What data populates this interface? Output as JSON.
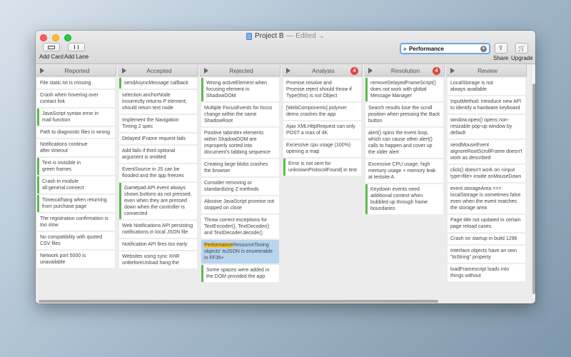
{
  "window": {
    "title": "Project B",
    "edited": "— Edited",
    "chevron": "⌄"
  },
  "toolbar": {
    "add_card": "Add Card",
    "add_lane": "Add Lane",
    "share": "Share",
    "upgrade": "Upgrade"
  },
  "search": {
    "value": "Performance",
    "icon": "search-icon",
    "clear": "×"
  },
  "lanes": [
    {
      "name": "Reported",
      "badge": "",
      "cards": [
        {
          "lines": [
            "File static.txt is missing"
          ],
          "flag": false
        },
        {
          "lines": [
            "Crash when hovering over",
            "contact link"
          ],
          "flag": false
        },
        {
          "lines": [
            "JavaScript syntax error in",
            "mail function"
          ],
          "flag": true
        },
        {
          "lines": [
            "Path to diagnostic files is wrong"
          ],
          "flag": false
        },
        {
          "lines": [
            "Notifications continue",
            "after timeout"
          ],
          "flag": false
        },
        {
          "lines": [
            "Text is invisible in",
            "green frames"
          ],
          "flag": true
        },
        {
          "lines": [
            "Crash in module",
            "all:general:connect"
          ],
          "flag": true
        },
        {
          "lines": [
            "Timeout/hang when returning",
            "from purchase page"
          ],
          "flag": true
        },
        {
          "lines": [
            "The registration confirmation is",
            "too slow"
          ],
          "flag": false
        },
        {
          "lines": [
            "No compatibility with quoted",
            "CSV files"
          ],
          "flag": false
        },
        {
          "lines": [
            "Network port 5000 is",
            "unavailable"
          ],
          "flag": false
        }
      ]
    },
    {
      "name": "Accepted",
      "badge": "",
      "cards": [
        {
          "lines": [
            "sendAsyncMessage callback"
          ],
          "flag": true
        },
        {
          "lines": [
            "selection.anchorNode",
            "incorrectly returns P element,",
            "should return text node"
          ],
          "flag": false
        },
        {
          "lines": [
            "Implement the Navigation",
            "Timing 2 spec"
          ],
          "flag": false
        },
        {
          "lines": [
            "Delayed iFrame request fails"
          ],
          "flag": false
        },
        {
          "lines": [
            "Add fails if third optional",
            "argument is omitted"
          ],
          "flag": false
        },
        {
          "lines": [
            "EventSource in JS can be",
            "flooded and the app freezes"
          ],
          "flag": false
        },
        {
          "lines": [
            "Gamepad API event always",
            "shows buttons as not pressed,",
            "even when they are pressed",
            "down when the controller is",
            "connected"
          ],
          "flag": true
        },
        {
          "lines": [
            "Web Notifications API persisting",
            "notifications in local JSON file"
          ],
          "flag": false
        },
        {
          "lines": [
            "Notification API fires too early"
          ],
          "flag": false
        },
        {
          "lines": [
            "Websites using sync XHR",
            "onBeforeUnload hang the"
          ],
          "flag": false
        }
      ]
    },
    {
      "name": "Rejected",
      "badge": "",
      "cards": [
        {
          "lines": [
            "Wrong activeElement when",
            "focusing element in",
            "ShadowDOM"
          ],
          "flag": true
        },
        {
          "lines": [
            "Multiple FocusEvents for focus",
            "change within the same",
            "ShadowRoot"
          ],
          "flag": false
        },
        {
          "lines": [
            "Positive tabindex elements",
            "within ShadowDOM are",
            "improperly sorted into",
            "document's tabbing sequence"
          ],
          "flag": false
        },
        {
          "lines": [
            "Creating large blobs crashes",
            "the browser"
          ],
          "flag": false
        },
        {
          "lines": [
            "Consider removing or",
            "standardizing Z methods"
          ],
          "flag": false
        },
        {
          "lines": [
            "Abusive JavaScript promise not",
            "stopped on close"
          ],
          "flag": false
        },
        {
          "lines": [
            "Throw correct exceptions for",
            "TextEncoder(), TextDecoder()",
            "and TextDecoder.decode()"
          ],
          "flag": false
        },
        {
          "lines": [
            "PerformanceResourceTiming",
            "objects' toJSON is enumerable",
            "in FF35+"
          ],
          "flag": false,
          "selected": true,
          "highlight": "Performance"
        },
        {
          "lines": [
            "Some spaces were added in",
            "the DOM provided the app"
          ],
          "flag": true
        }
      ]
    },
    {
      "name": "Analysis",
      "badge": "4",
      "cards": [
        {
          "lines": [
            "Promise.resolve and",
            "Promise.reject should throw if",
            "Type(this) is not Object"
          ],
          "flag": false
        },
        {
          "lines": [
            "[WebComponents] polymer",
            "demo crashes the app"
          ],
          "flag": false
        },
        {
          "lines": [
            "Ajax XMLHttpRequest can only",
            "POST a max of 4K"
          ],
          "flag": false
        },
        {
          "lines": [
            "Excessive cpu usage (100%)",
            "opening a map"
          ],
          "flag": false
        },
        {
          "lines": [
            "Error is not sent for",
            "unknownProtocolFound| in test"
          ],
          "flag": true
        }
      ]
    },
    {
      "name": "Resolution",
      "badge": "4",
      "cards": [
        {
          "lines": [
            "removeDelayedFrameScript()",
            "does not work with global",
            "Message Manager"
          ],
          "flag": true
        },
        {
          "lines": [
            "Search results lose the scroll",
            "position when pressing the Back",
            "button"
          ],
          "flag": false
        },
        {
          "lines": [
            "alert() spins the event loop,",
            "which can cause other alert()",
            "calls to happen and cover up",
            "the older alert"
          ],
          "flag": false
        },
        {
          "lines": [
            "Excessive CPU usage, high",
            "memory usage + memory leak",
            "at testsite A"
          ],
          "flag": false
        },
        {
          "lines": [
            "Keydown events need",
            "additional context when",
            "bubbled up through frame",
            "boundaries"
          ],
          "flag": true
        }
      ]
    },
    {
      "name": "Review",
      "badge": "",
      "cards": [
        {
          "lines": [
            "LocalStorage is not",
            "always available"
          ],
          "flag": false
        },
        {
          "lines": [
            "InputMethod: introduce new API",
            "to identify a hardware keyboard"
          ],
          "flag": false
        },
        {
          "lines": [
            "window.open() opens non-",
            "resizable pop-up window by",
            "default"
          ],
          "flag": false
        },
        {
          "lines": [
            "sendMouseEvent",
            "aIgnoreRootScrollFrame doesn't",
            "work as described"
          ],
          "flag": false
        },
        {
          "lines": [
            "click() doesn't work on <input",
            "type=file> inside onMouseDown"
          ],
          "flag": false
        },
        {
          "lines": [
            "event.storageArea ===",
            "localStorage is sometimes false",
            "even when the event matches",
            "the storage area"
          ],
          "flag": false
        },
        {
          "lines": [
            "Page title not updated in certain",
            "page reload cases"
          ],
          "flag": false
        },
        {
          "lines": [
            "Crash on startup in build 1296"
          ],
          "flag": false
        },
        {
          "lines": [
            "Interface objects have an own",
            "\"toString\" property"
          ],
          "flag": false
        },
        {
          "lines": [
            "loadFramescript loads into",
            "things without"
          ],
          "flag": false
        }
      ]
    }
  ]
}
